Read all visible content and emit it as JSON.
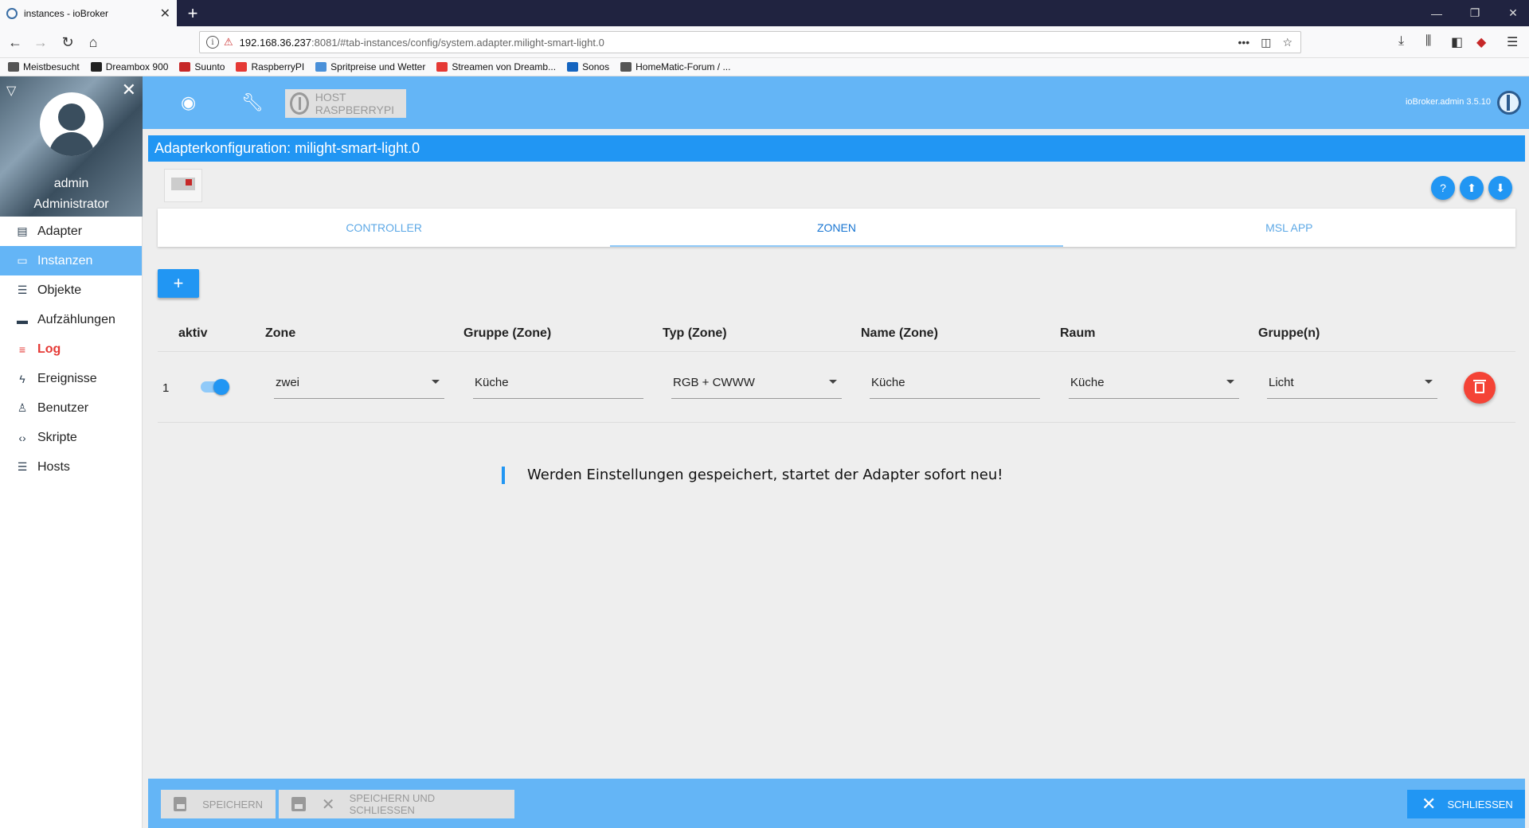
{
  "browser": {
    "tab_title": "instances - ioBroker",
    "url_host": "192.168.36.237",
    "url_rest": ":8081/#tab-instances/config/system.adapter.milight-smart-light.0",
    "bookmarks": [
      "Meistbesucht",
      "Dreambox 900",
      "Suunto",
      "RaspberryPI",
      "Spritpreise und Wetter",
      "Streamen von Dreamb...",
      "Sonos",
      "HomeMatic-Forum / ..."
    ],
    "bookmark_colors": [
      "#555555",
      "#222222",
      "#c62828",
      "#e53935",
      "#4a90d9",
      "#e53935",
      "#1565c0",
      "#555555"
    ]
  },
  "sidebar": {
    "username": "admin",
    "role": "Administrator",
    "items": [
      {
        "label": "Adapter",
        "icon": "store-icon",
        "glyph": "▤"
      },
      {
        "label": "Instanzen",
        "icon": "instances-icon",
        "glyph": "▭"
      },
      {
        "label": "Objekte",
        "icon": "list-icon",
        "glyph": "☰"
      },
      {
        "label": "Aufzählungen",
        "icon": "enum-icon",
        "glyph": "▬"
      },
      {
        "label": "Log",
        "icon": "log-icon",
        "glyph": "≡"
      },
      {
        "label": "Ereignisse",
        "icon": "bolt-icon",
        "glyph": "ϟ"
      },
      {
        "label": "Benutzer",
        "icon": "user-icon",
        "glyph": "♙"
      },
      {
        "label": "Skripte",
        "icon": "code-icon",
        "glyph": "‹›"
      },
      {
        "label": "Hosts",
        "icon": "hosts-icon",
        "glyph": "☰"
      }
    ]
  },
  "topbar": {
    "host_label": "HOST RASPBERRYPI",
    "version": "ioBroker.admin 3.5.10"
  },
  "page": {
    "title": "Adapterkonfiguration: milight-smart-light.0"
  },
  "tabs": [
    "CONTROLLER",
    "ZONEN",
    "MSL APP"
  ],
  "table": {
    "headers": [
      "aktiv",
      "Zone",
      "Gruppe (Zone)",
      "Typ (Zone)",
      "Name (Zone)",
      "Raum",
      "Gruppe(n)"
    ],
    "rows": [
      {
        "index": "1",
        "active": true,
        "zone": "zwei",
        "group_zone": "Küche",
        "type_zone": "RGB + CWWW",
        "name_zone": "Küche",
        "room": "Küche",
        "groups": "Licht"
      }
    ]
  },
  "notice": "Werden Einstellungen gespeichert, startet der Adapter sofort neu!",
  "footer": {
    "save": "SPEICHERN",
    "save_close": "SPEICHERN UND SCHLIESSEN",
    "close": "SCHLIESSEN"
  },
  "colors": {
    "accent": "#2196f3",
    "topbar": "#64b5f6",
    "delete": "#f44336",
    "log": "#e53935"
  }
}
